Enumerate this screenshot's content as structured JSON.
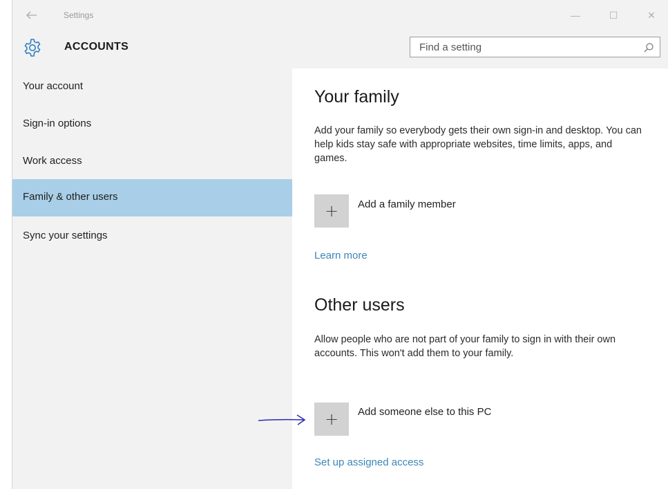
{
  "window": {
    "title": "Settings",
    "back_icon": "back-arrow-icon",
    "minimize_glyph": "—",
    "maximize_glyph": "☐",
    "close_glyph": "✕"
  },
  "header": {
    "title": "ACCOUNTS",
    "icon": "gear-icon"
  },
  "search": {
    "placeholder": "Find a setting",
    "icon": "search-icon"
  },
  "sidebar": {
    "items": [
      {
        "label": "Your account",
        "active": false
      },
      {
        "label": "Sign-in options",
        "active": false
      },
      {
        "label": "Work access",
        "active": false
      },
      {
        "label": "Family & other users",
        "active": true
      },
      {
        "label": "Sync your settings",
        "active": false
      }
    ]
  },
  "main": {
    "family": {
      "heading": "Your family",
      "description": "Add your family so everybody gets their own sign-in and desktop. You can help kids stay safe with appropriate websites, time limits, apps, and games.",
      "add_label": "Add a family member",
      "plus_glyph": "+",
      "link": "Learn more"
    },
    "other": {
      "heading": "Other users",
      "description": "Allow people who are not part of your family to sign in with their own accounts. This won't add them to your family.",
      "add_label": "Add someone else to this PC",
      "plus_glyph": "+",
      "link": "Set up assigned access"
    }
  },
  "colors": {
    "active_nav": "#a9cfe8",
    "link": "#3a86b8",
    "annotation_arrow": "#2b2bb0"
  }
}
